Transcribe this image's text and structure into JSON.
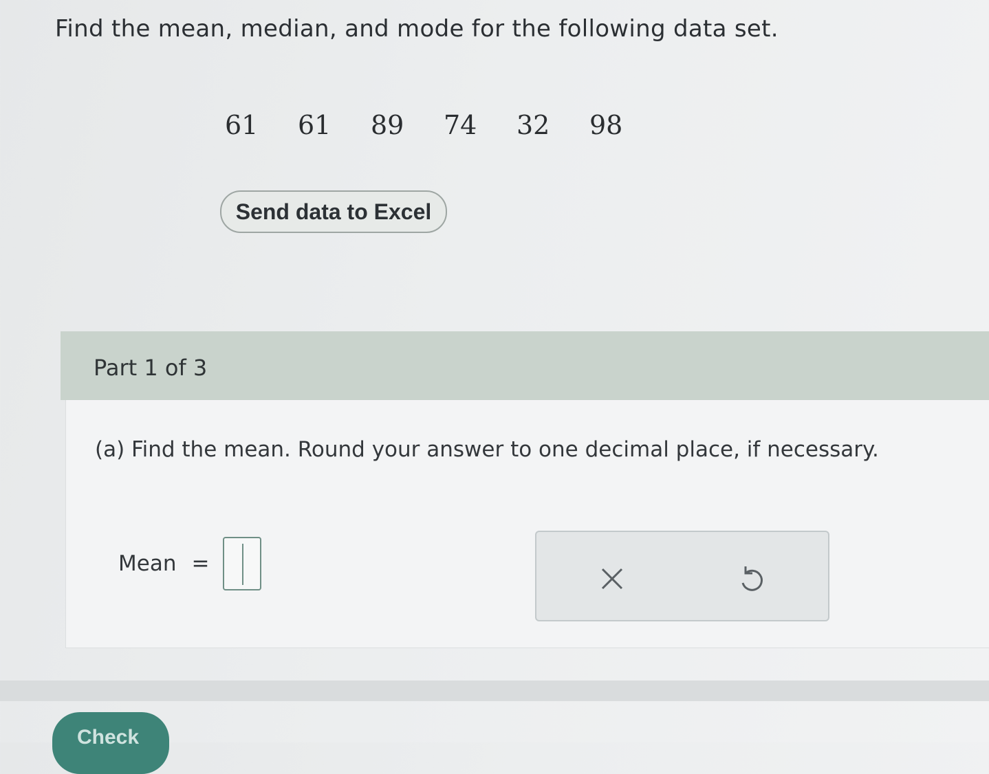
{
  "question": "Find the mean, median, and mode for the following data set.",
  "dataset": [
    "61",
    "61",
    "89",
    "74",
    "32",
    "98"
  ],
  "excel_button": "Send data to Excel",
  "part": {
    "label": "Part 1 of 3",
    "instruction": "(a) Find the mean. Round your answer to one decimal place, if necessary.",
    "answer_label": "Mean",
    "equals": "=",
    "answer_value": ""
  },
  "tools": {
    "clear_icon": "close-icon",
    "undo_icon": "undo-icon"
  },
  "check_button": "Check",
  "colors": {
    "header": "#c9d3cc",
    "accent": "#3e8478",
    "input_border": "#6f8f86"
  }
}
